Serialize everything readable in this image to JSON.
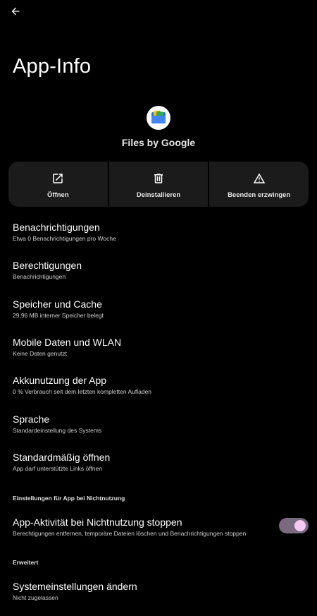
{
  "header": {
    "back_icon": "arrow-left-icon",
    "title": "App-Info"
  },
  "app": {
    "icon": "files-folder-icon",
    "name": "Files by Google"
  },
  "actions": [
    {
      "label": "Öffnen",
      "icon": "open-external-icon"
    },
    {
      "label": "Deinstallieren",
      "icon": "trash-icon"
    },
    {
      "label": "Beenden erzwingen",
      "icon": "warning-icon"
    }
  ],
  "settings": [
    {
      "title": "Benachrichtigungen",
      "subtitle": "Etwa 0 Benachrichtigungen pro Woche"
    },
    {
      "title": "Berechtigungen",
      "subtitle": "Benachrichtigungen"
    },
    {
      "title": "Speicher und Cache",
      "subtitle": "29,96 MB interner Speicher belegt"
    },
    {
      "title": "Mobile Daten und WLAN",
      "subtitle": "Keine Daten genutzt"
    },
    {
      "title": "Akkunutzung der App",
      "subtitle": "0 % Verbrauch seit dem letzten kompletten Aufladen"
    },
    {
      "title": "Sprache",
      "subtitle": "Standardeinstellung des Systems"
    },
    {
      "title": "Standardmäßig öffnen",
      "subtitle": "App darf unterstützte Links öffnen"
    }
  ],
  "unused_section": {
    "header": "Einstellungen für App bei Nichtnutzung",
    "item": {
      "title": "App-Aktivität bei Nichtnutzung stoppen",
      "subtitle": "Berechtigungen entfernen, temporäre Dateien löschen und Benachrichtigungen stoppen",
      "toggle_on": true
    }
  },
  "advanced_section": {
    "header": "Erweitert",
    "item": {
      "title": "Systemeinstellungen ändern",
      "subtitle": "Nicht zugelassen"
    }
  },
  "colors": {
    "background": "#000000",
    "card": "#1b1b1b",
    "toggle_track": "#7a6a80",
    "toggle_thumb": "#f6c9f4"
  }
}
